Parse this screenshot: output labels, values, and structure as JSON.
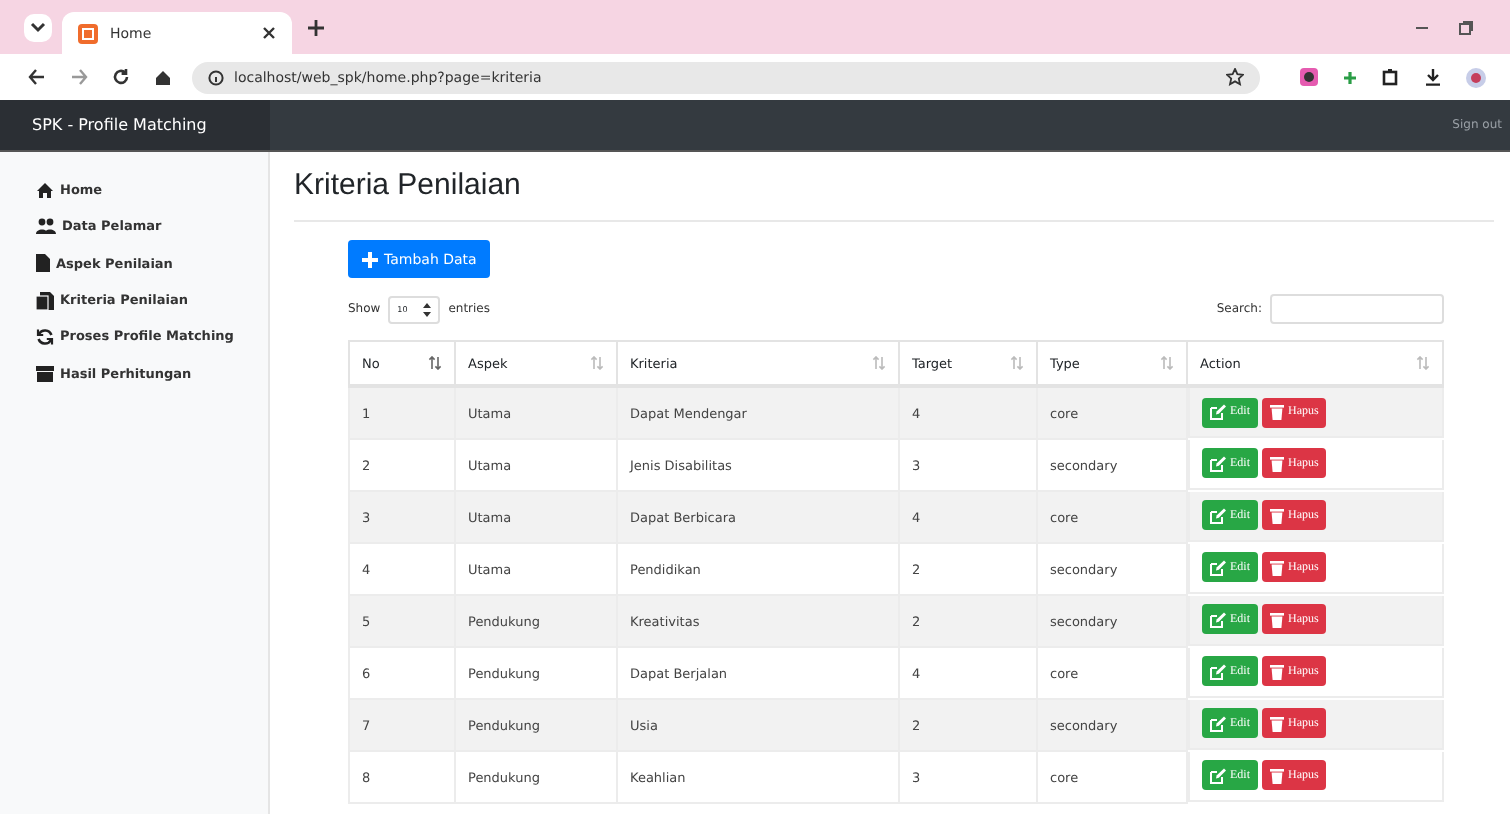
{
  "browser": {
    "tab_title": "Home",
    "url": "localhost/web_spk/home.php?page=kriteria"
  },
  "navbar": {
    "brand": "SPK - Profile Matching",
    "sign_out": "Sign out"
  },
  "sidebar": {
    "items": [
      {
        "label": "Home",
        "kind": "home"
      },
      {
        "label": "Data Pelamar",
        "kind": "users"
      },
      {
        "label": "Aspek Penilaian",
        "kind": "file"
      },
      {
        "label": "Kriteria Penilaian",
        "kind": "files"
      },
      {
        "label": "Proses Profile Matching",
        "kind": "refresh"
      },
      {
        "label": "Hasil Perhitungan",
        "kind": "archive"
      }
    ]
  },
  "page_title": "Kriteria Penilaian",
  "add_button": "Tambah Data",
  "length": {
    "show": "Show",
    "value": "10",
    "entries": "entries"
  },
  "search": {
    "label": "Search:"
  },
  "table": {
    "columns": [
      "No",
      "Aspek",
      "Kriteria",
      "Target",
      "Type",
      "Action"
    ],
    "rows": [
      {
        "cells": [
          "1",
          "Utama",
          "Dapat Mendengar",
          "4",
          "core"
        ],
        "edit": "Edit",
        "delete": "Hapus"
      },
      {
        "cells": [
          "2",
          "Utama",
          "Jenis Disabilitas",
          "3",
          "secondary"
        ],
        "edit": "Edit",
        "delete": "Hapus"
      },
      {
        "cells": [
          "3",
          "Utama",
          "Dapat Berbicara",
          "4",
          "core"
        ],
        "edit": "Edit",
        "delete": "Hapus"
      },
      {
        "cells": [
          "4",
          "Utama",
          "Pendidikan",
          "2",
          "secondary"
        ],
        "edit": "Edit",
        "delete": "Hapus"
      },
      {
        "cells": [
          "5",
          "Pendukung",
          "Kreativitas",
          "2",
          "secondary"
        ],
        "edit": "Edit",
        "delete": "Hapus"
      },
      {
        "cells": [
          "6",
          "Pendukung",
          "Dapat Berjalan",
          "4",
          "core"
        ],
        "edit": "Edit",
        "delete": "Hapus"
      },
      {
        "cells": [
          "7",
          "Pendukung",
          "Usia",
          "2",
          "secondary"
        ],
        "edit": "Edit",
        "delete": "Hapus"
      },
      {
        "cells": [
          "8",
          "Pendukung",
          "Keahlian",
          "3",
          "core"
        ],
        "edit": "Edit",
        "delete": "Hapus"
      }
    ]
  }
}
